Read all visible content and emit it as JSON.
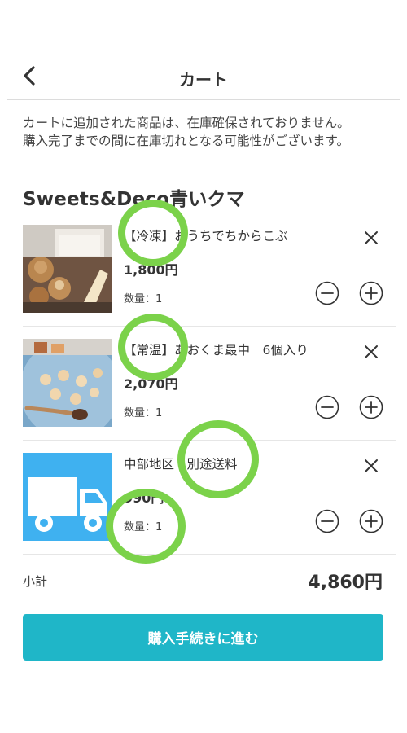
{
  "header": {
    "title": "カート",
    "back_icon": "chevron-left-icon"
  },
  "notice": {
    "line1": "カートに追加された商品は、在庫確保されておりません。",
    "line2": "購入完了までの間に在庫切れとなる可能性がございます。"
  },
  "shop": {
    "name": "Sweets&Deco青いクマ"
  },
  "items": [
    {
      "name": "【冷凍】おうちでちからこぶ",
      "price": "1,800円",
      "quantity": "数量：1",
      "image": "sweets-photo"
    },
    {
      "name": "【常温】あおくま最中　6個入り",
      "price": "2,070円",
      "quantity": "数量：1",
      "image": "cookies-photo"
    },
    {
      "name": "中部地区　別途送料",
      "price": "990円",
      "quantity": "数量：1",
      "image": "delivery-truck-icon"
    }
  ],
  "subtotal": {
    "label": "小計",
    "value": "4,860円"
  },
  "checkout": {
    "label": "購入手続きに進む"
  },
  "colors": {
    "accent": "#1fb6c8",
    "highlight": "#7bd24a",
    "truck_bg": "#3fb1f0"
  }
}
